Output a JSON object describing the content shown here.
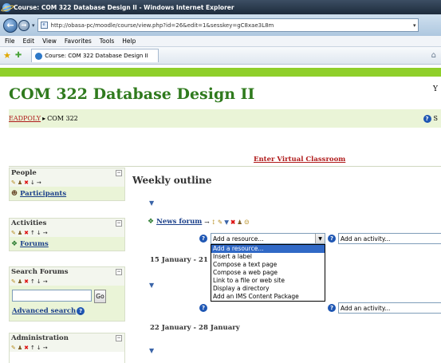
{
  "window": {
    "title": "Course: COM 322 Database Design II - Windows Internet Explorer"
  },
  "address_bar": {
    "url": "http://obasa-pc/moodle/course/view.php?id=26&edit=1&sesskey=gC8xae3L8m"
  },
  "menu": [
    "File",
    "Edit",
    "View",
    "Favorites",
    "Tools",
    "Help"
  ],
  "tab": {
    "label": "Course: COM 322 Database Design II"
  },
  "page": {
    "course_title": "COM 322 Database Design II",
    "user_letter_partial": "Y",
    "breadcrumb": {
      "home": "EADPOLY",
      "separator": "▸",
      "current": "COM 322"
    },
    "help_right_partial": "S",
    "enter_virtual_classroom": "Enter Virtual Classroom"
  },
  "sidebar": {
    "people": {
      "title": "People",
      "participants": "Participants"
    },
    "activities": {
      "title": "Activities",
      "forums": "Forums"
    },
    "search_forums": {
      "title": "Search Forums",
      "go": "Go",
      "advanced_search": "Advanced search"
    },
    "administration": {
      "title": "Administration"
    },
    "collapse_symbol": "−"
  },
  "main": {
    "weekly_outline": "Weekly outline",
    "news_forum": "News forum",
    "add_resource_placeholder": "Add a resource...",
    "add_activity_placeholder": "Add an activity...",
    "dropdown_options": [
      "Add a resource...",
      "Insert a label",
      "Compose a text page",
      "Compose a web page",
      "Link to a file or web site",
      "Display a directory",
      "Add an IMS Content Package"
    ],
    "selected_option_index": 0,
    "week1_heading_partial": "15 January - 21",
    "week2_heading": "22 January - 28 January"
  },
  "colors": {
    "title_green": "#2f7a1d",
    "link_red": "#b01b1b",
    "link_blue": "#1a3f8a",
    "band_green": "#8fcf2a",
    "block_bg": "#eaf4d7",
    "selection_blue": "#3169c6"
  }
}
